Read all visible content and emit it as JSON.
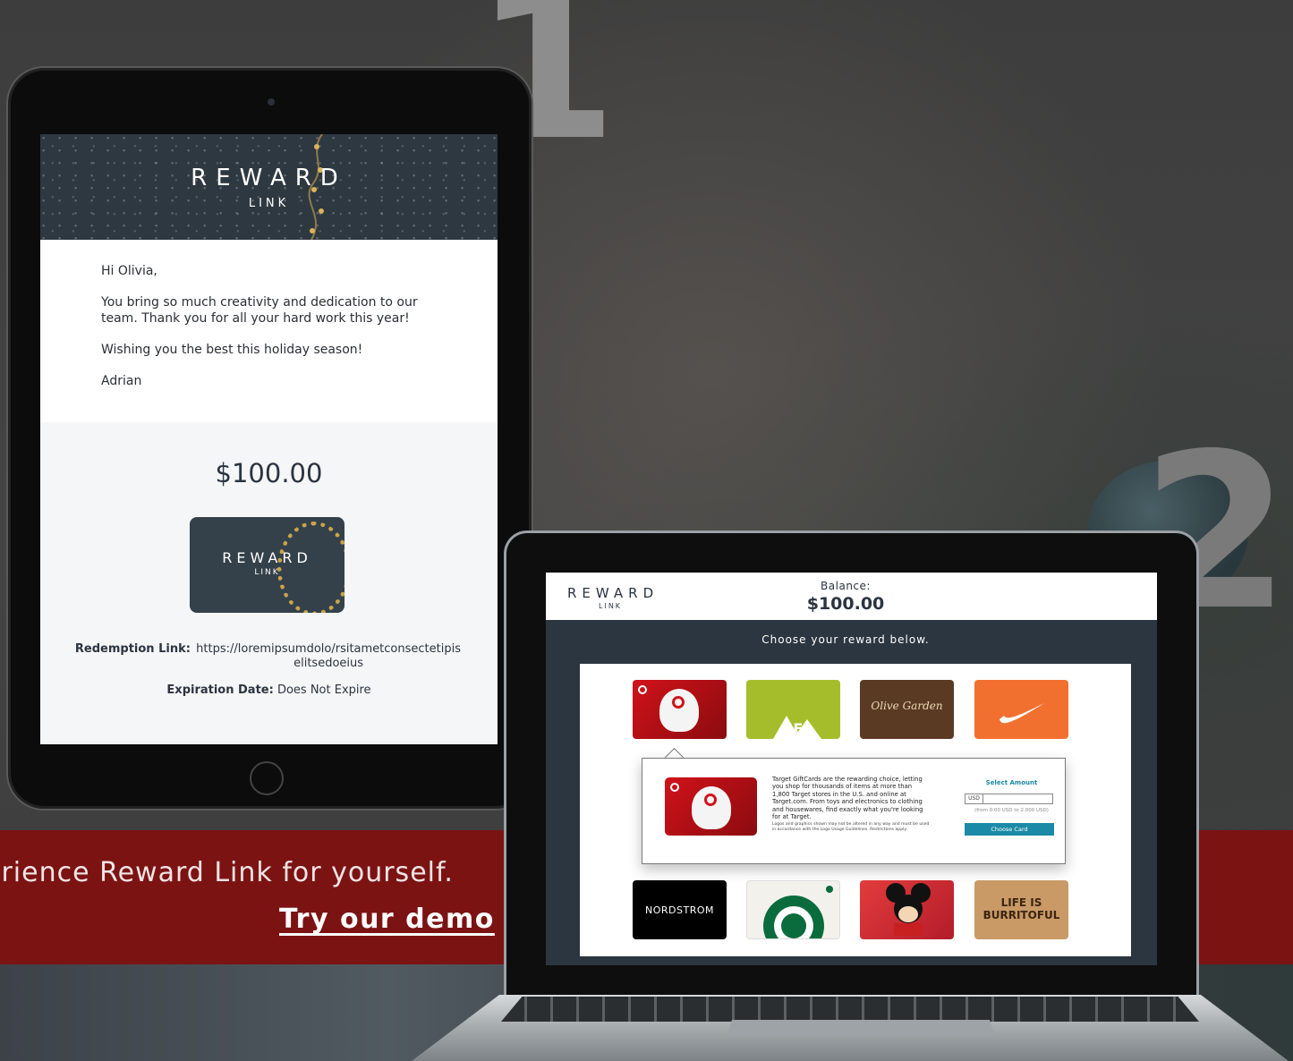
{
  "decor": {
    "step1": "1",
    "step2": "2"
  },
  "email": {
    "logo_main": "REWARD",
    "logo_sub": "LINK",
    "greeting": "Hi Olivia,",
    "paragraph1": "You bring so much creativity and dedication to our team. Thank you for all your hard work this year!",
    "paragraph2": "Wishing you the best this holiday season!",
    "signoff": "Adrian",
    "amount": "$100.00",
    "card_logo_main": "REWARD",
    "card_logo_sub": "LINK",
    "redemption_label": "Redemption Link:",
    "redemption_value": "https://loremipsumdolo/rsitametconsectetipiselitsedoeius",
    "expiration_label": "Expiration Date:",
    "expiration_value": "Does Not Expire"
  },
  "banner": {
    "text": "erience Reward Link for yourself.",
    "link_label": "Try our demo"
  },
  "laptop": {
    "logo_main": "REWARD",
    "logo_sub": "LINK",
    "balance_label": "Balance:",
    "balance_value": "$100.00",
    "choose_prompt": "Choose your reward below.",
    "tiles": {
      "target": "Target",
      "rei": "REI",
      "olive_garden": "Olive Garden",
      "nike": "Nike",
      "nordstrom": "NORDSTROM",
      "starbucks": "Starbucks",
      "disney": "Disney",
      "life_is_good": "LIFE IS BURRITOFUL"
    },
    "popup": {
      "description": "Target GiftCards are the rewarding choice, letting you shop for thousands of items at more than 1,800 Target stores in the U.S. and online at Target.com. From toys and electronics to clothing and housewares, find exactly what you're looking for at Target.",
      "legal": "Logos and graphics shown may not be altered in any way and must be used in accordance with the Logo Usage Guidelines. Restrictions apply.",
      "select_title": "Select Amount",
      "currency": "USD",
      "range": "(from 0.00 USD to 2,000 USD)",
      "button_label": "Choose Card"
    }
  }
}
